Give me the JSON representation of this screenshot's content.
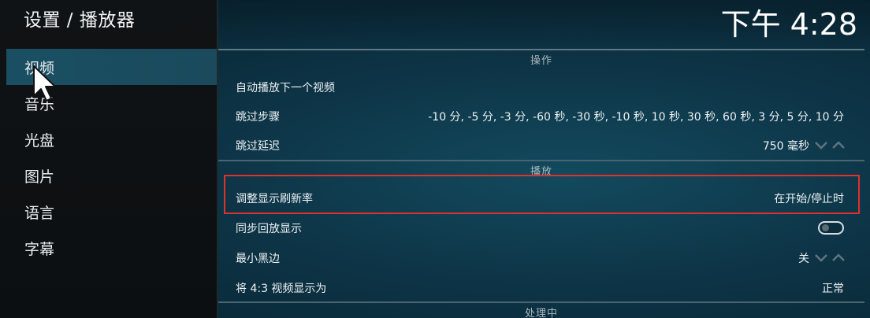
{
  "header": {
    "title": "设置 / 播放器",
    "clock": "下午 4:28"
  },
  "sidebar": {
    "items": [
      {
        "label": "视频",
        "active": true
      },
      {
        "label": "音乐"
      },
      {
        "label": "光盘"
      },
      {
        "label": "图片"
      },
      {
        "label": "语言"
      },
      {
        "label": "字幕"
      }
    ]
  },
  "sections": [
    {
      "title": "操作",
      "rows": [
        {
          "label": "自动播放下一个视频",
          "value": ""
        },
        {
          "label": "跳过步骤",
          "value": "-10 分, -5 分, -3 分, -60 秒, -30 秒, -10 秒, 10 秒, 30 秒, 60 秒, 3 分, 5 分, 10 分"
        },
        {
          "label": "跳过延迟",
          "value": "750 毫秒"
        }
      ]
    },
    {
      "title": "播放",
      "rows": [
        {
          "label": "调整显示刷新率",
          "value": "在开始/停止时"
        },
        {
          "label": "同步回放显示",
          "value": ""
        },
        {
          "label": "最小黑边",
          "value": "关"
        },
        {
          "label": "将 4:3 视频显示为",
          "value": "正常"
        }
      ]
    },
    {
      "title": "处理中",
      "rows": []
    }
  ],
  "colors": {
    "highlight": "#e0312a",
    "active_nav": "#1a4f63"
  },
  "icons": {
    "cursor": "arrow-cursor-icon",
    "spinner_down": "chevron-down-icon",
    "spinner_up": "chevron-up-icon",
    "toggle": "toggle-switch-icon"
  }
}
